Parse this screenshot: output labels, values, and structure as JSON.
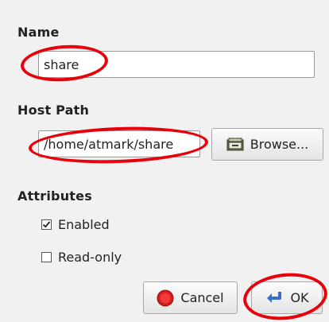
{
  "name_section": {
    "label": "Name",
    "value": "share"
  },
  "host_path_section": {
    "label": "Host Path",
    "value": "/home/atmark/share",
    "browse_label": "Browse...",
    "browse_icon": "folder-icon"
  },
  "attributes_section": {
    "label": "Attributes",
    "enabled_label": "Enabled",
    "enabled_checked": true,
    "readonly_label": "Read-only",
    "readonly_checked": false
  },
  "buttons": {
    "cancel_label": "Cancel",
    "cancel_icon": "stop-icon",
    "ok_label": "OK",
    "ok_icon": "return-arrow-icon"
  },
  "colors": {
    "annotation": "#e8000b",
    "cancel_icon": "#d81b1b",
    "ok_icon": "#3a6fc9"
  }
}
